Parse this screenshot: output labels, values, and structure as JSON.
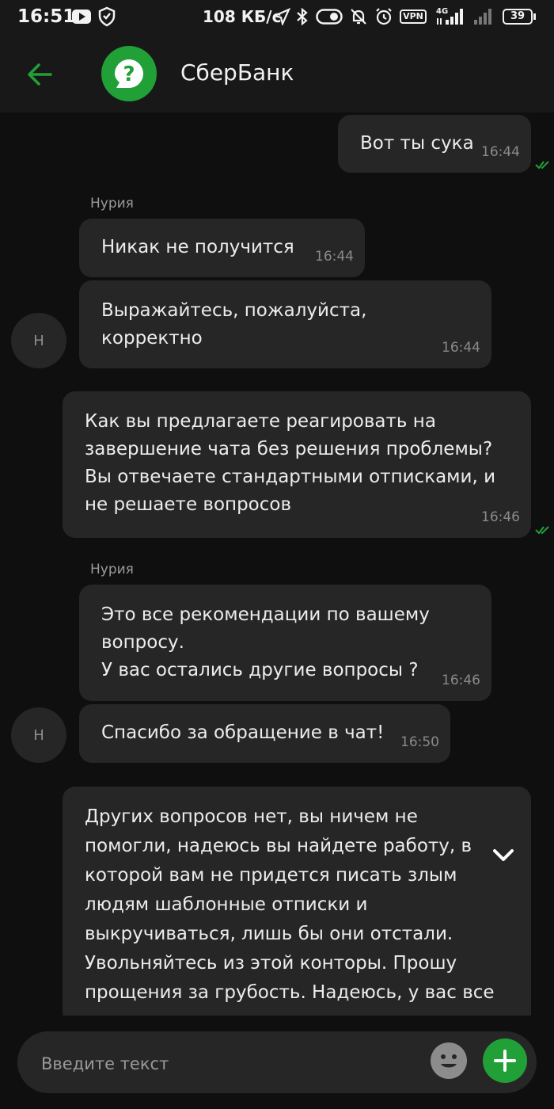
{
  "status_bar": {
    "time": "16:51",
    "speed": "108 КБ/с",
    "vpn": "VPN",
    "network": "4G",
    "battery": "39"
  },
  "header": {
    "title": "СберБанк",
    "avatar_icon": "question-bubble-icon",
    "accent_color": "#21a038"
  },
  "messages": [
    {
      "text": "Вот ты сука",
      "time": "16:44"
    },
    {
      "sender": "Нурия",
      "text": "Никак не получится",
      "time": "16:44"
    },
    {
      "text": "Выражайтесь, пожалуйста,\nкорректно",
      "time": "16:44"
    },
    {
      "avatar": "Н"
    },
    {
      "text": "Как вы предлагаете реагировать на\nзавершение чата без решения проблемы?\nВы отвечаете стандартными отписками, и\nне решаете вопросов",
      "time": "16:46"
    },
    {
      "sender": "Нурия",
      "text": "Это все рекомендации по вашему\nвопросу.\nУ вас остались другие вопросы ?",
      "time": "16:46"
    },
    {
      "text": "Спасибо за обращение в чат!",
      "time": "16:50"
    },
    {
      "avatar": "Н"
    },
    {
      "text": "Других вопросов нет, вы ничем не\nпомогли, надеюсь вы найдете работу, в\nкоторой вам не придется писать злым\nлюдям шаблонные отписки и\nвыкручиваться, лишь бы они отстали.\nУвольняйтесь из этой конторы. Прошу\nпрощения за грубость. Надеюсь, у вас все"
    }
  ],
  "composer": {
    "placeholder": "Введите текст",
    "emoji_icon": "emoji-icon",
    "add_icon": "plus-icon"
  }
}
